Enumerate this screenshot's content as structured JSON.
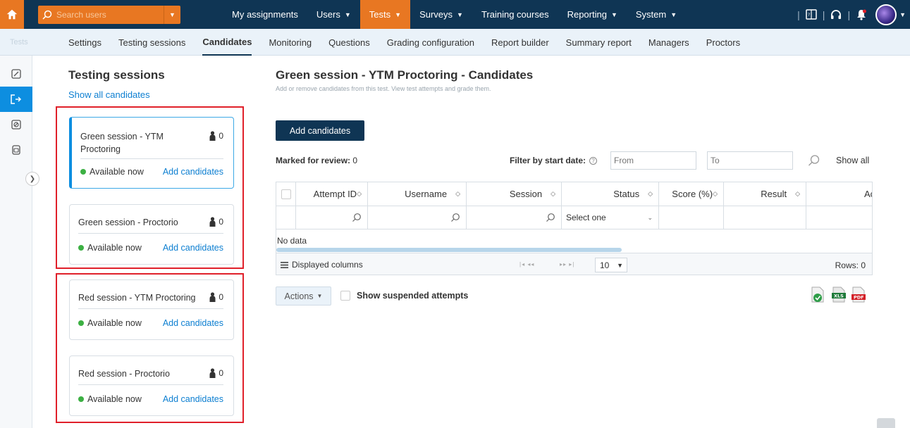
{
  "topbar": {
    "search_placeholder": "Search users",
    "nav": [
      {
        "label": "My assignments",
        "caret": false,
        "active": false
      },
      {
        "label": "Users",
        "caret": true,
        "active": false
      },
      {
        "label": "Tests",
        "caret": true,
        "active": true
      },
      {
        "label": "Surveys",
        "caret": true,
        "active": false
      },
      {
        "label": "Training courses",
        "caret": false,
        "active": false
      },
      {
        "label": "Reporting",
        "caret": true,
        "active": false
      },
      {
        "label": "System",
        "caret": true,
        "active": false
      }
    ]
  },
  "subnav": {
    "section_label": "Tests",
    "links": [
      "Settings",
      "Testing sessions",
      "Candidates",
      "Monitoring",
      "Questions",
      "Grading configuration",
      "Report builder",
      "Summary report",
      "Managers",
      "Proctors"
    ],
    "active": "Candidates"
  },
  "sidebar": {
    "title": "Testing sessions",
    "show_all": "Show all candidates",
    "sessions": [
      {
        "name": "Green session - YTM Proctoring",
        "count": "0",
        "status": "Available now",
        "add": "Add candidates"
      },
      {
        "name": "Green session - Proctorio",
        "count": "0",
        "status": "Available now",
        "add": "Add candidates"
      },
      {
        "name": "Red session - YTM Proctoring",
        "count": "0",
        "status": "Available now",
        "add": "Add candidates"
      },
      {
        "name": "Red session - Proctorio",
        "count": "0",
        "status": "Available now",
        "add": "Add candidates"
      }
    ]
  },
  "main": {
    "title": "Green session - YTM Proctoring - Candidates",
    "subtitle": "Add or remove candidates from this test. View test attempts and grade them.",
    "add_button": "Add candidates",
    "marked_label": "Marked for review:",
    "marked_value": "0",
    "filter_label": "Filter by start date:",
    "from_placeholder": "From",
    "to_placeholder": "To",
    "show_all": "Show all",
    "columns": [
      "Attempt ID",
      "Username",
      "Session",
      "Status",
      "Score (%)",
      "Result",
      "Ac"
    ],
    "status_filter": "Select one",
    "no_data": "No data",
    "displayed_columns": "Displayed columns",
    "page_size": "10",
    "rows_label": "Rows: 0",
    "actions": "Actions",
    "show_suspended": "Show suspended attempts"
  },
  "colors": {
    "topbar": "#0f3554",
    "accent": "#e87722",
    "link": "#0d7fd1",
    "highlight_box": "#e0202a"
  }
}
